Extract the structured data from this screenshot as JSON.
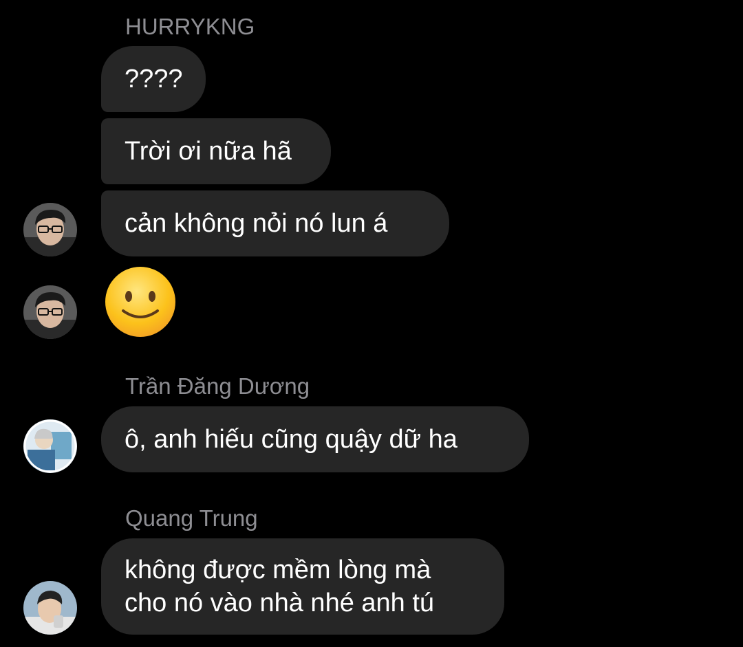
{
  "messages": [
    {
      "sender": "HURRYKNG",
      "bubbles": [
        "????",
        "Trời ơi nữa hã",
        "cản không nỏi nó lun á"
      ],
      "reaction_emoji": "slightly-smiling-face"
    },
    {
      "sender": "Trần Đăng Dương",
      "bubbles": [
        "ô, anh hiếu cũng quậy dữ ha"
      ]
    },
    {
      "sender": "Quang Trung",
      "bubbles": [
        "không được mềm lòng mà",
        "cho nó vào nhà nhé anh tú"
      ]
    }
  ],
  "colors": {
    "background": "#000000",
    "bubble": "#262626",
    "sender_name": "#8e8e93",
    "text": "#ffffff"
  }
}
